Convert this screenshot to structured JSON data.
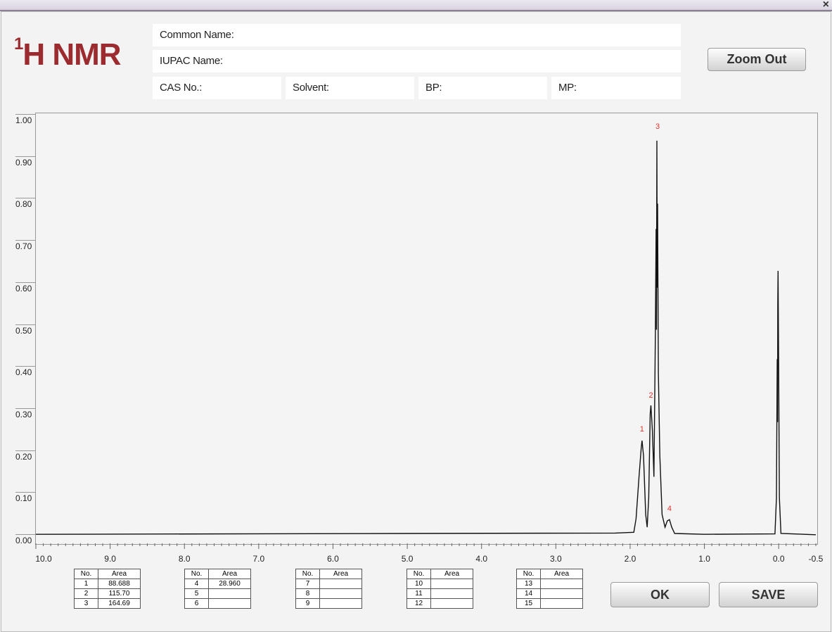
{
  "window": {
    "close_glyph": "×"
  },
  "header": {
    "title_sup": "1",
    "title_main": "H NMR",
    "common_name_label": "Common Name:",
    "iupac_name_label": "IUPAC Name:",
    "cas_label": "CAS No.:",
    "solvent_label": "Solvent:",
    "bp_label": "BP:",
    "mp_label": "MP:"
  },
  "buttons": {
    "zoom_out": "Zoom Out",
    "ok": "OK",
    "save": "SAVE"
  },
  "chart_data": {
    "type": "line",
    "x_range": [
      10.0,
      -0.5
    ],
    "y_range": [
      0.0,
      1.0
    ],
    "x_ticks": [
      "10.0",
      "9.0",
      "8.0",
      "7.0",
      "6.0",
      "5.0",
      "4.0",
      "3.0",
      "2.0",
      "1.0",
      "0.0",
      "-0.5"
    ],
    "y_ticks": [
      "1.00",
      "0.90",
      "0.80",
      "0.70",
      "0.60",
      "0.50",
      "0.40",
      "0.30",
      "0.20",
      "0.10",
      "0.00"
    ],
    "peak_labels": [
      {
        "label": "1",
        "x": 1.84,
        "y": 0.25
      },
      {
        "label": "2",
        "x": 1.72,
        "y": 0.33
      },
      {
        "label": "3",
        "x": 1.63,
        "y": 0.97
      },
      {
        "label": "4",
        "x": 1.47,
        "y": 0.06
      }
    ],
    "spectrum_points": [
      [
        10.0,
        0.013
      ],
      [
        5.0,
        0.015
      ],
      [
        2.2,
        0.016
      ],
      [
        1.95,
        0.018
      ],
      [
        1.92,
        0.05
      ],
      [
        1.88,
        0.15
      ],
      [
        1.85,
        0.22
      ],
      [
        1.84,
        0.236
      ],
      [
        1.82,
        0.2
      ],
      [
        1.79,
        0.06
      ],
      [
        1.77,
        0.03
      ],
      [
        1.75,
        0.1
      ],
      [
        1.73,
        0.3
      ],
      [
        1.72,
        0.32
      ],
      [
        1.7,
        0.26
      ],
      [
        1.68,
        0.15
      ],
      [
        1.66,
        0.5
      ],
      [
        1.65,
        0.74
      ],
      [
        1.645,
        0.5
      ],
      [
        1.64,
        0.95
      ],
      [
        1.635,
        0.6
      ],
      [
        1.63,
        0.8
      ],
      [
        1.62,
        0.4
      ],
      [
        1.6,
        0.2
      ],
      [
        1.57,
        0.06
      ],
      [
        1.53,
        0.03
      ],
      [
        1.5,
        0.045
      ],
      [
        1.47,
        0.048
      ],
      [
        1.44,
        0.03
      ],
      [
        1.4,
        0.015
      ],
      [
        1.0,
        0.013
      ],
      [
        0.05,
        0.014
      ],
      [
        0.03,
        0.1
      ],
      [
        0.02,
        0.43
      ],
      [
        0.015,
        0.28
      ],
      [
        0.012,
        0.56
      ],
      [
        0.008,
        0.64
      ],
      [
        0.0,
        0.4
      ],
      [
        -0.01,
        0.1
      ],
      [
        -0.03,
        0.015
      ],
      [
        -0.5,
        0.012
      ]
    ]
  },
  "peak_tables": [
    {
      "no_header": "No.",
      "area_header": "Area",
      "rows": [
        {
          "no": "1",
          "area": "88.688"
        },
        {
          "no": "2",
          "area": "115.70"
        },
        {
          "no": "3",
          "area": "164.69"
        }
      ]
    },
    {
      "no_header": "No.",
      "area_header": "Area",
      "rows": [
        {
          "no": "4",
          "area": "28.960"
        },
        {
          "no": "5",
          "area": ""
        },
        {
          "no": "6",
          "area": ""
        }
      ]
    },
    {
      "no_header": "No.",
      "area_header": "Area",
      "rows": [
        {
          "no": "7",
          "area": ""
        },
        {
          "no": "8",
          "area": ""
        },
        {
          "no": "9",
          "area": ""
        }
      ]
    },
    {
      "no_header": "No.",
      "area_header": "Area",
      "rows": [
        {
          "no": "10",
          "area": ""
        },
        {
          "no": "11",
          "area": ""
        },
        {
          "no": "12",
          "area": ""
        }
      ]
    },
    {
      "no_header": "No.",
      "area_header": "Area",
      "rows": [
        {
          "no": "13",
          "area": ""
        },
        {
          "no": "14",
          "area": ""
        },
        {
          "no": "15",
          "area": ""
        }
      ]
    }
  ]
}
